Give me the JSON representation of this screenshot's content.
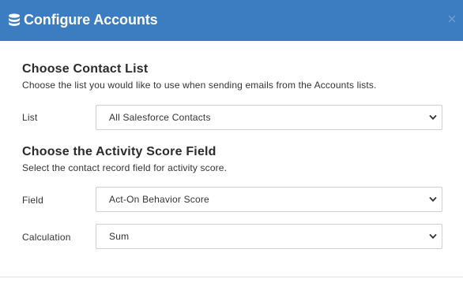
{
  "header": {
    "title": "Configure Accounts",
    "icon": "database-icon",
    "close_glyph": "×",
    "background": "#3c7cc0"
  },
  "contact_list": {
    "title": "Choose Contact List",
    "description": "Choose the list you would like to use when sending emails from the Accounts lists.",
    "list_label": "List",
    "list_value": "All Salesforce Contacts"
  },
  "activity_score": {
    "title": "Choose the Activity Score Field",
    "description": "Select the contact record field for activity score.",
    "field_label": "Field",
    "field_value": "Act-On Behavior Score",
    "calculation_label": "Calculation",
    "calculation_value": "Sum"
  }
}
